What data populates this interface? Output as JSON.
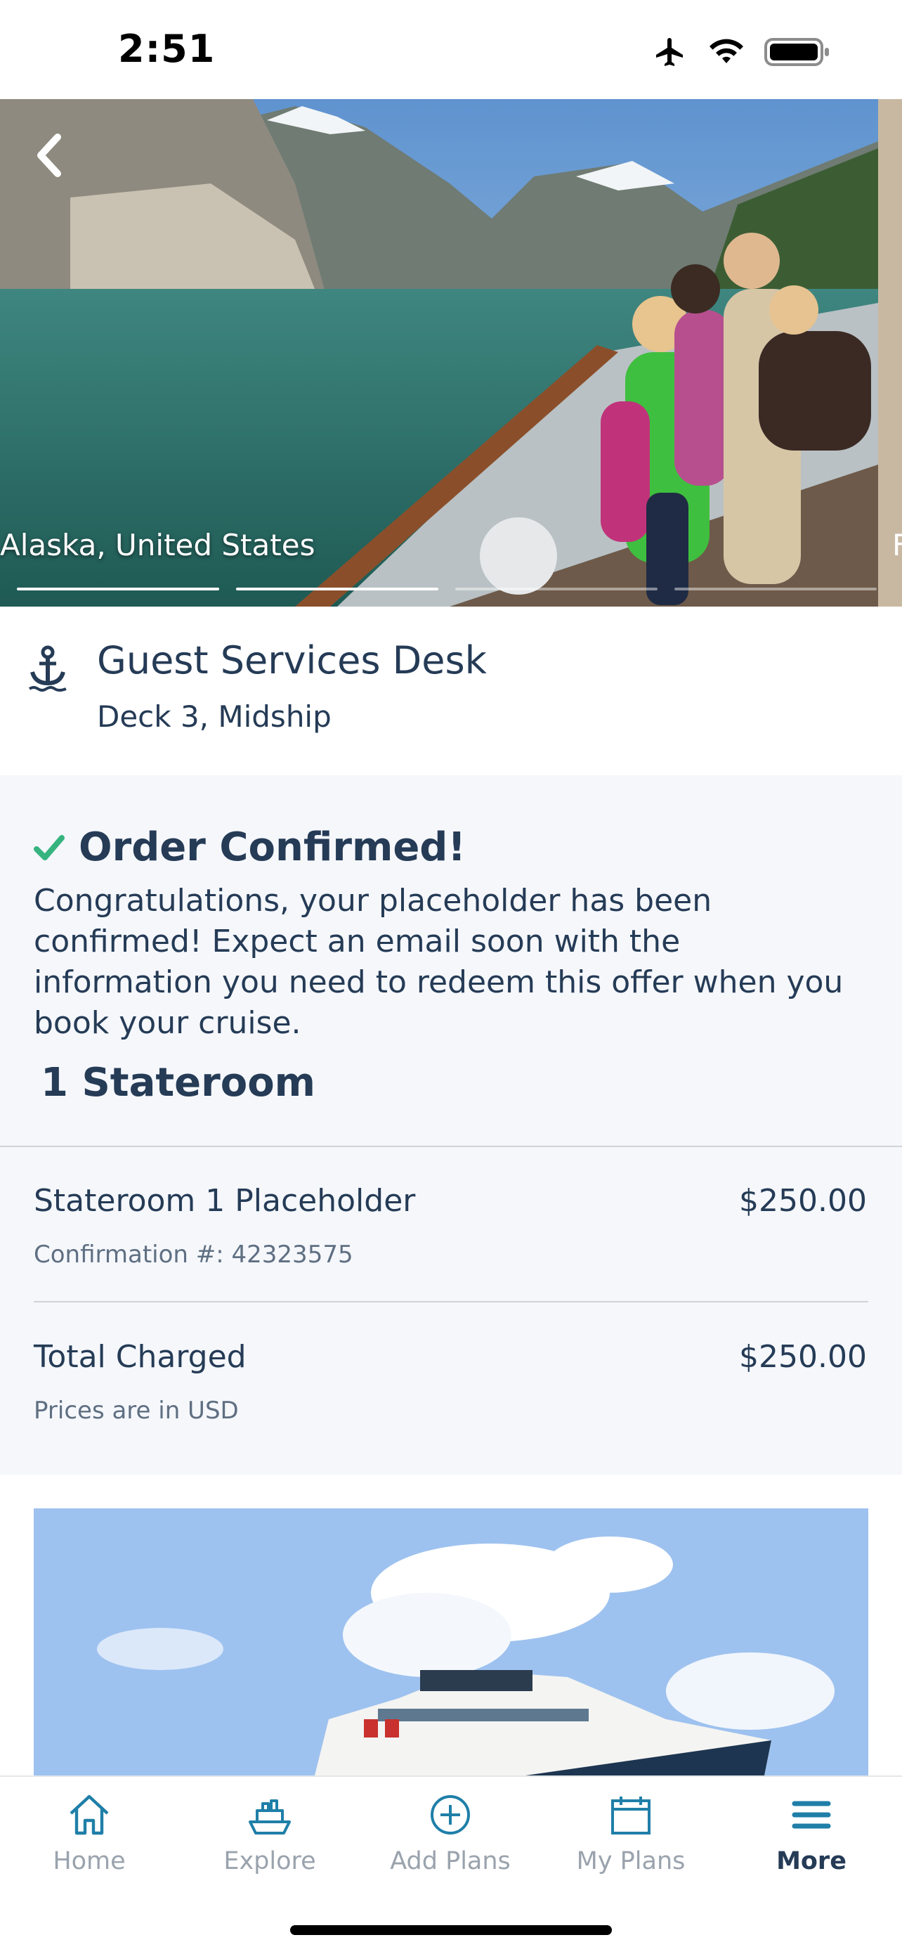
{
  "status_bar": {
    "time": "2:51"
  },
  "hero": {
    "location": "Alaska, United States",
    "next_location_peek": "F",
    "pager": {
      "count": 4,
      "active": [
        0,
        1
      ]
    }
  },
  "location": {
    "title": "Guest Services Desk",
    "subtitle": "Deck 3, Midship"
  },
  "confirmation": {
    "title": "Order Confirmed!",
    "message": "Congratulations, your placeholder has been confirmed! Expect an email soon with the information you need to redeem this offer when you book your cruise."
  },
  "order": {
    "heading": "1 Stateroom",
    "items": [
      {
        "label": "Stateroom 1 Placeholder",
        "price": "$250.00",
        "note": "Confirmation #: 42323575"
      }
    ],
    "total": {
      "label": "Total Charged",
      "price": "$250.00",
      "note": "Prices are in USD"
    }
  },
  "tabs": [
    {
      "label": "Home",
      "icon": "home-icon",
      "active": false
    },
    {
      "label": "Explore",
      "icon": "ship-icon",
      "active": false
    },
    {
      "label": "Add Plans",
      "icon": "plus-circle-icon",
      "active": false
    },
    {
      "label": "My Plans",
      "icon": "calendar-icon",
      "active": false
    },
    {
      "label": "More",
      "icon": "menu-icon",
      "active": true
    }
  ],
  "colors": {
    "primary": "#253b56",
    "accent": "#1f7fa8",
    "success": "#36b37e",
    "inactive": "#9aa3ad"
  }
}
